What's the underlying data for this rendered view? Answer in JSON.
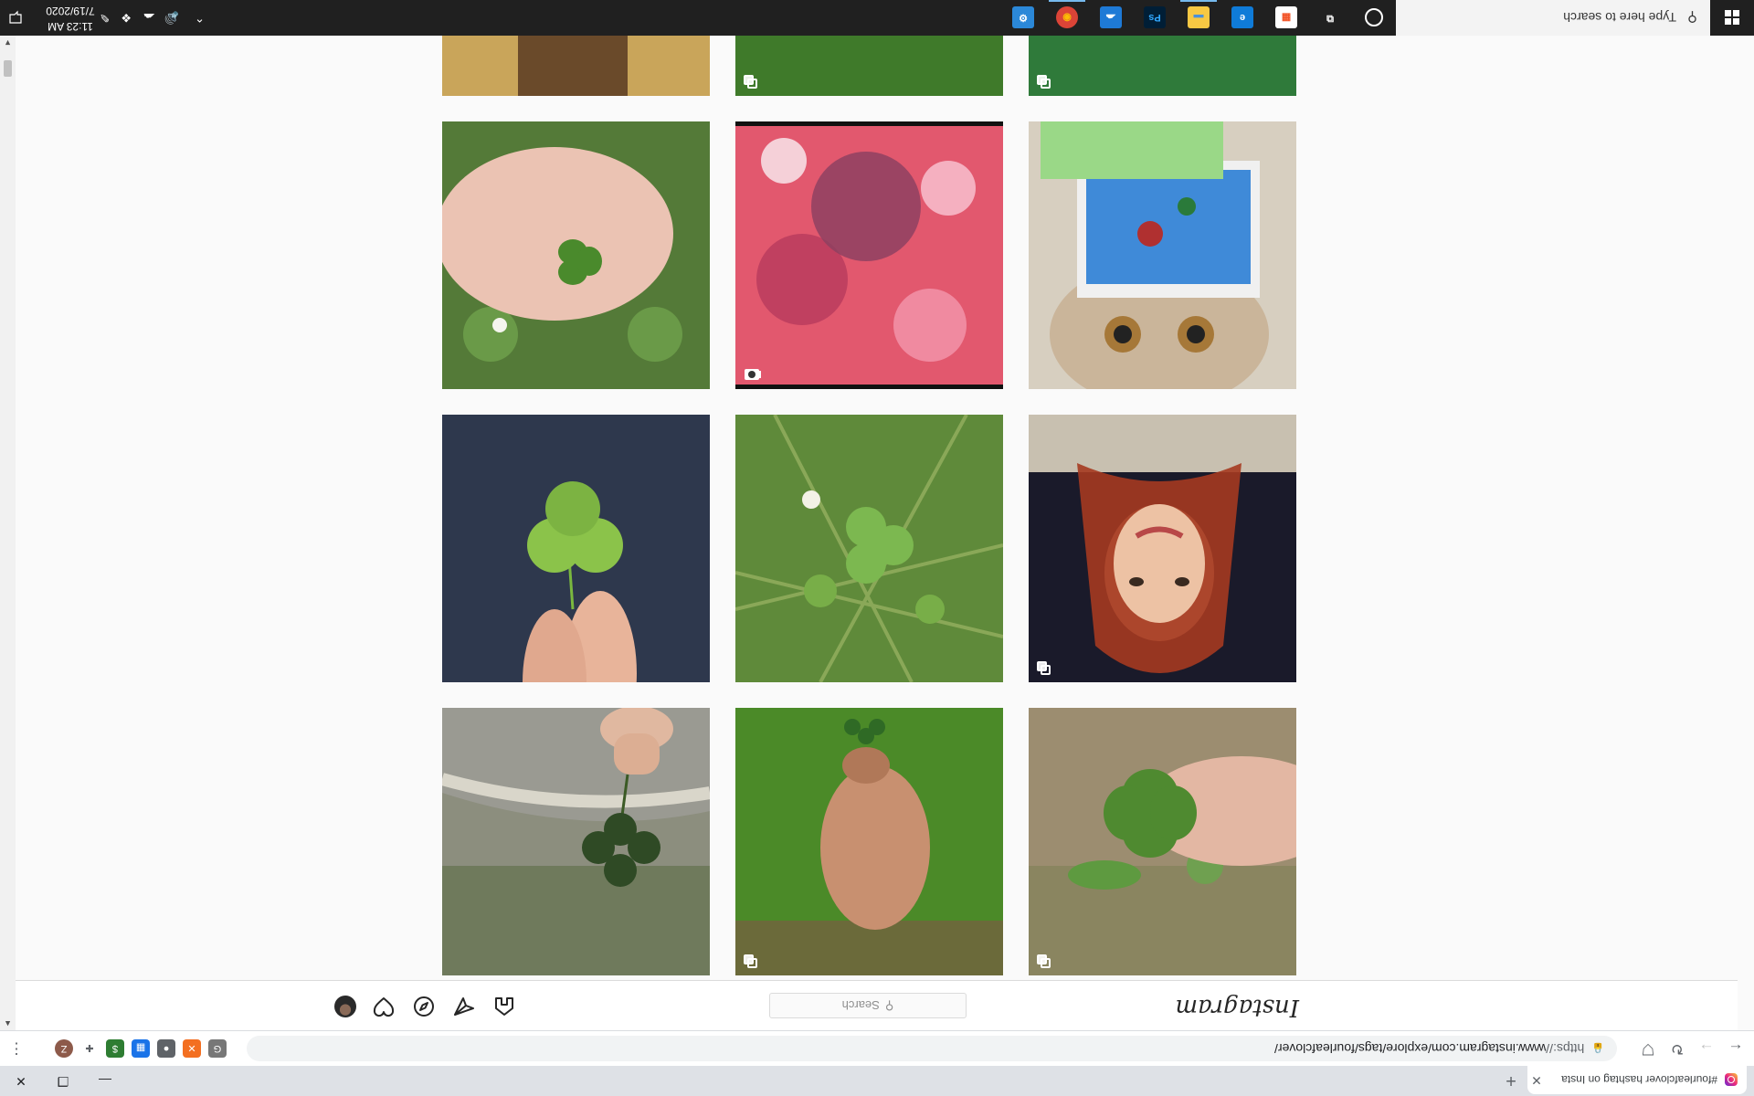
{
  "browser": {
    "tab_title": "#fourleafclover hashtag on Insta",
    "url_protocol": "https://",
    "url_rest": "www.instagram.com/explore/tags/fourleafclover/",
    "extensions": [
      {
        "name": "extension-gray-square-icon",
        "color": "#777777",
        "glyph": "G"
      },
      {
        "name": "extension-orange-x-icon",
        "color": "#f36f21",
        "glyph": "✕"
      },
      {
        "name": "extension-gray-circle-icon",
        "color": "#5f6368",
        "glyph": "●"
      },
      {
        "name": "extension-blue-grid-icon",
        "color": "#1a73e8",
        "glyph": "▦"
      },
      {
        "name": "extension-green-s-icon",
        "color": "#2e7d32",
        "glyph": "$"
      },
      {
        "name": "extensions-puzzle-icon",
        "color": "#ffffff",
        "glyph": "✚"
      },
      {
        "name": "profile-avatar-z",
        "color": "#8d5a4a",
        "glyph": "Z"
      }
    ]
  },
  "instagram": {
    "logo_text": "Instagram",
    "search_placeholder": "Search",
    "search_glyph": "⚲"
  },
  "taskbar": {
    "search_placeholder": "Type here to search",
    "time": "11:23 AM",
    "date": "7/19/2020",
    "apps": [
      {
        "name": "cortana-icon",
        "glyph": "○",
        "bg": "transparent",
        "fg": "#ffffff"
      },
      {
        "name": "task-view-icon",
        "glyph": "⧉",
        "bg": "transparent",
        "fg": "#ffffff"
      },
      {
        "name": "microsoft-store-icon",
        "glyph": "▦",
        "bg": "#ffffff",
        "fg": "#f25022"
      },
      {
        "name": "edge-icon",
        "glyph": "e",
        "bg": "#0f7bd8",
        "fg": "#ffffff"
      },
      {
        "name": "file-explorer-icon",
        "glyph": "▬",
        "bg": "#f7c843",
        "fg": "#4a90d9"
      },
      {
        "name": "photoshop-icon",
        "glyph": "Ps",
        "bg": "#001e36",
        "fg": "#31a8ff"
      },
      {
        "name": "onedrive-app-icon",
        "glyph": "☁",
        "bg": "#1e7ad6",
        "fg": "#ffffff"
      },
      {
        "name": "chrome-icon",
        "glyph": "◉",
        "bg": "#db4437",
        "fg": "#fbbc05"
      },
      {
        "name": "settings-app-icon",
        "glyph": "⚙",
        "bg": "#2b88d8",
        "fg": "#ffffff"
      }
    ],
    "tray_icons": [
      {
        "name": "show-hidden-icons-chevron-icon",
        "glyph": "⌃"
      },
      {
        "name": "volume-icon",
        "glyph": "🔊"
      },
      {
        "name": "onedrive-tray-icon",
        "glyph": "☁"
      },
      {
        "name": "dropbox-tray-icon",
        "glyph": "❖"
      },
      {
        "name": "pen-tray-icon",
        "glyph": "✎"
      }
    ]
  },
  "posts": [
    {
      "name": "post-hand-clover-wall",
      "kind": "image",
      "badge": "none",
      "bg": "#7d8a6a"
    },
    {
      "name": "post-girl-picking-clover",
      "kind": "image",
      "badge": "multi",
      "bg": "#4d7d2a"
    },
    {
      "name": "post-fingers-four-leaf-clover",
      "kind": "image",
      "badge": "multi",
      "bg": "#8a8a5a"
    },
    {
      "name": "post-fingers-clover-dark-background",
      "kind": "image",
      "badge": "none",
      "bg": "#2c3548"
    },
    {
      "name": "post-clover-patch-grass",
      "kind": "image",
      "badge": "none",
      "bg": "#6a9a3a"
    },
    {
      "name": "post-red-haired-woman-selfie",
      "kind": "image",
      "badge": "multi",
      "bg": "#4a3a4a"
    },
    {
      "name": "post-hand-clover-in-palm",
      "kind": "image",
      "badge": "none",
      "bg": "#7aa05a"
    },
    {
      "name": "post-pink-blurred-video",
      "kind": "video",
      "badge": "video",
      "bg": "#e04a6a"
    },
    {
      "name": "post-cat-july-calendar-card",
      "kind": "image",
      "badge": "none",
      "bg": "#c8b8a0"
    },
    {
      "name": "post-jar-partial",
      "kind": "image",
      "badge": "none",
      "bg": "#b08a50"
    },
    {
      "name": "post-clover-leaves-partial",
      "kind": "image",
      "badge": "multi",
      "bg": "#4a8a3a"
    },
    {
      "name": "post-green-leaves-partial",
      "kind": "image",
      "badge": "multi",
      "bg": "#3a9a4a"
    }
  ]
}
